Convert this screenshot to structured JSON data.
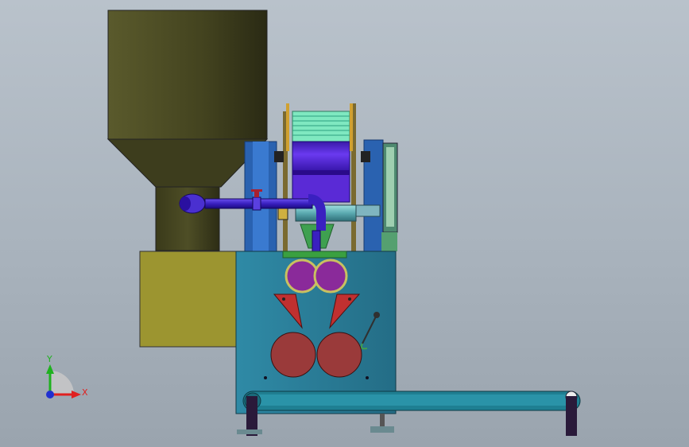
{
  "triad": {
    "y_label": "Y",
    "x_label": "X",
    "colors": {
      "y": "#1fb11f",
      "x": "#e02020",
      "origin": "#2030d0"
    }
  },
  "model": {
    "parts": [
      "hopper",
      "hopper-neck",
      "feed-pipe",
      "valve",
      "film-roll",
      "upper-rollers",
      "cutter-blades",
      "lower-rollers",
      "machine-body",
      "motor-box",
      "conveyor-belt",
      "support-legs",
      "lever-arm"
    ],
    "colors": {
      "hopper": "#4a4a22",
      "motor_box": "#9c9530",
      "machine_body": "#2a7e99",
      "conveyor": "#1f7f92",
      "film": "#5a2ad6",
      "rollers_purple": "#8a2a9a",
      "rollers_red": "#9a3a3a",
      "side_plate": "#2a62b0"
    }
  }
}
